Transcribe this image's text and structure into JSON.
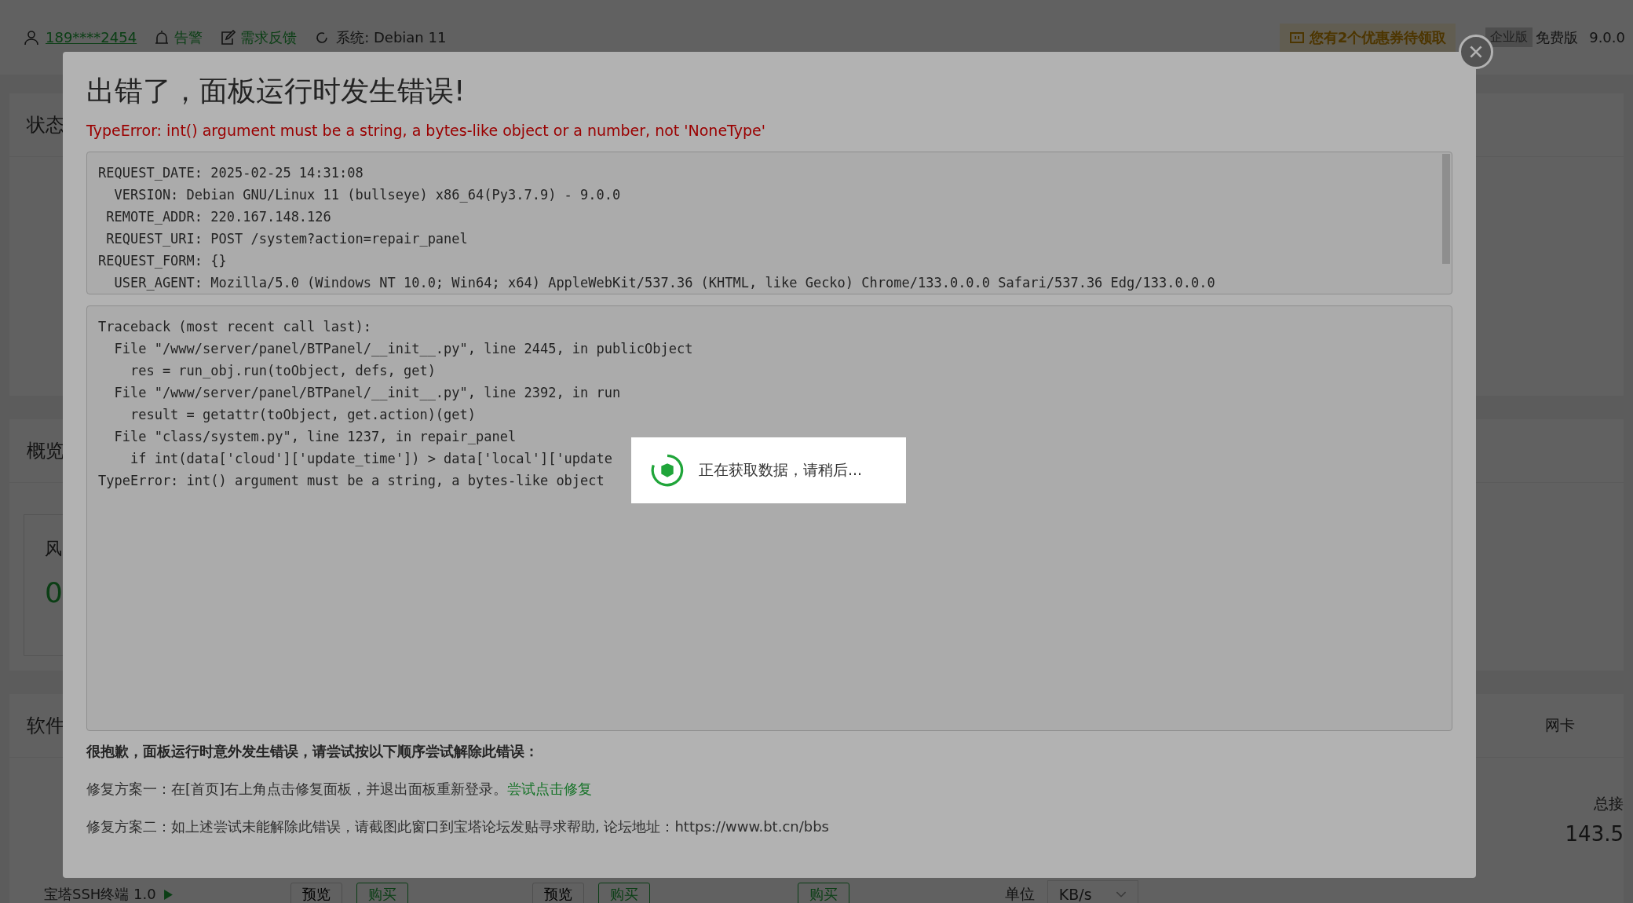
{
  "header": {
    "user": "189****2454",
    "links": [
      {
        "kind": "alarm",
        "label": "告警"
      },
      {
        "kind": "feedback",
        "label": "需求反馈"
      }
    ],
    "system": "系统:  Debian 11",
    "coupon": "您有2个优惠券待领取",
    "edition_badge": "企业版",
    "edition": "免费版",
    "version": "9.0.0"
  },
  "status_card": {
    "title": "状态"
  },
  "overview_card": {
    "title": "概览",
    "tile_label": "风",
    "tile_value": "0"
  },
  "software_card": {
    "title": "软件",
    "item": "宝塔SSH终端 1.0",
    "actions": [
      {
        "kind": "preview",
        "label": "预览"
      },
      {
        "kind": "buy",
        "label": "购买"
      },
      {
        "kind": "preview",
        "label": "预览"
      },
      {
        "kind": "buy",
        "label": "购买"
      },
      {
        "kind": "buy",
        "label": "购买"
      }
    ],
    "nic_label": "网卡",
    "total_label": "总接",
    "total_value": "143.5",
    "unit_label": "单位",
    "unit_value": "KB/s"
  },
  "error_dialog": {
    "title": "出错了，面板运行时发生错误!",
    "error": "TypeError: int() argument must be a string, a bytes-like object or a number, not 'NoneType'",
    "request_lines": [
      "REQUEST_DATE: 2025-02-25 14:31:08",
      "  VERSION: Debian GNU/Linux 11 (bullseye) x86_64(Py3.7.9) - 9.0.0",
      " REMOTE_ADDR: 220.167.148.126",
      " REQUEST_URI: POST /system?action=repair_panel",
      "REQUEST_FORM: {}",
      "  USER_AGENT: Mozilla/5.0 (Windows NT 10.0; Win64; x64) AppleWebKit/537.36 (KHTML, like Gecko) Chrome/133.0.0.0 Safari/537.36 Edg/133.0.0.0"
    ],
    "traceback_lines": [
      "Traceback (most recent call last):",
      "  File \"/www/server/panel/BTPanel/__init__.py\", line 2445, in publicObject",
      "    res = run_obj.run(toObject, defs, get)",
      "  File \"/www/server/panel/BTPanel/__init__.py\", line 2392, in run",
      "    result = getattr(toObject, get.action)(get)",
      "  File \"class/system.py\", line 1237, in repair_panel",
      "    if int(data['cloud']['update_time']) > data['local']['update",
      "TypeError: int() argument must be a string, a bytes-like object"
    ],
    "advice": "很抱歉，面板运行时意外发生错误，请尝试按以下顺序尝试解除此错误：",
    "fix_one": "修复方案一：在[首页]右上角点击修复面板，并退出面板重新登录。",
    "fix_one_link": "尝试点击修复",
    "fix_two": "修复方案二：如上述尝试未能解除此错误，请截图此窗口到宝塔论坛发贴寻求帮助, 论坛地址：https://www.bt.cn/bbs"
  },
  "loading_toast": {
    "message": "正在获取数据，请稍后..."
  }
}
